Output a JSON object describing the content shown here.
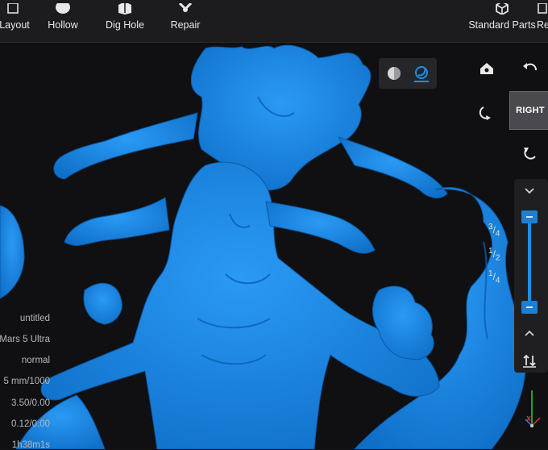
{
  "toolbar": {
    "items": [
      {
        "label": "Layout",
        "icon": "layout-icon"
      },
      {
        "label": "Hollow",
        "icon": "hollow-icon"
      },
      {
        "label": "Dig Hole",
        "icon": "dig-hole-icon"
      },
      {
        "label": "Repair",
        "icon": "repair-icon"
      },
      {
        "label": "Standard Parts",
        "icon": "standard-parts-icon"
      },
      {
        "label": "Re",
        "icon": "re-icon"
      }
    ]
  },
  "viewport": {
    "model_color": "#1a86e6",
    "background": "#101012",
    "view_cube_label": "RIGHT",
    "render_modes": [
      "solid-shading-icon",
      "wireframe-shading-icon"
    ],
    "active_render_mode": "wireframe-shading-icon"
  },
  "layer_slider": {
    "fractions": [
      {
        "num": "3",
        "den": "4"
      },
      {
        "num": "1",
        "den": "2"
      },
      {
        "num": "1",
        "den": "4"
      }
    ],
    "accent": "#1e8fe0"
  },
  "print_info": {
    "lines": [
      "untitled",
      "Mars 5 Ultra",
      "normal",
      "5 mm/1000",
      "3.50/0.00",
      "0.12/0.00",
      "1h38m1s"
    ]
  }
}
